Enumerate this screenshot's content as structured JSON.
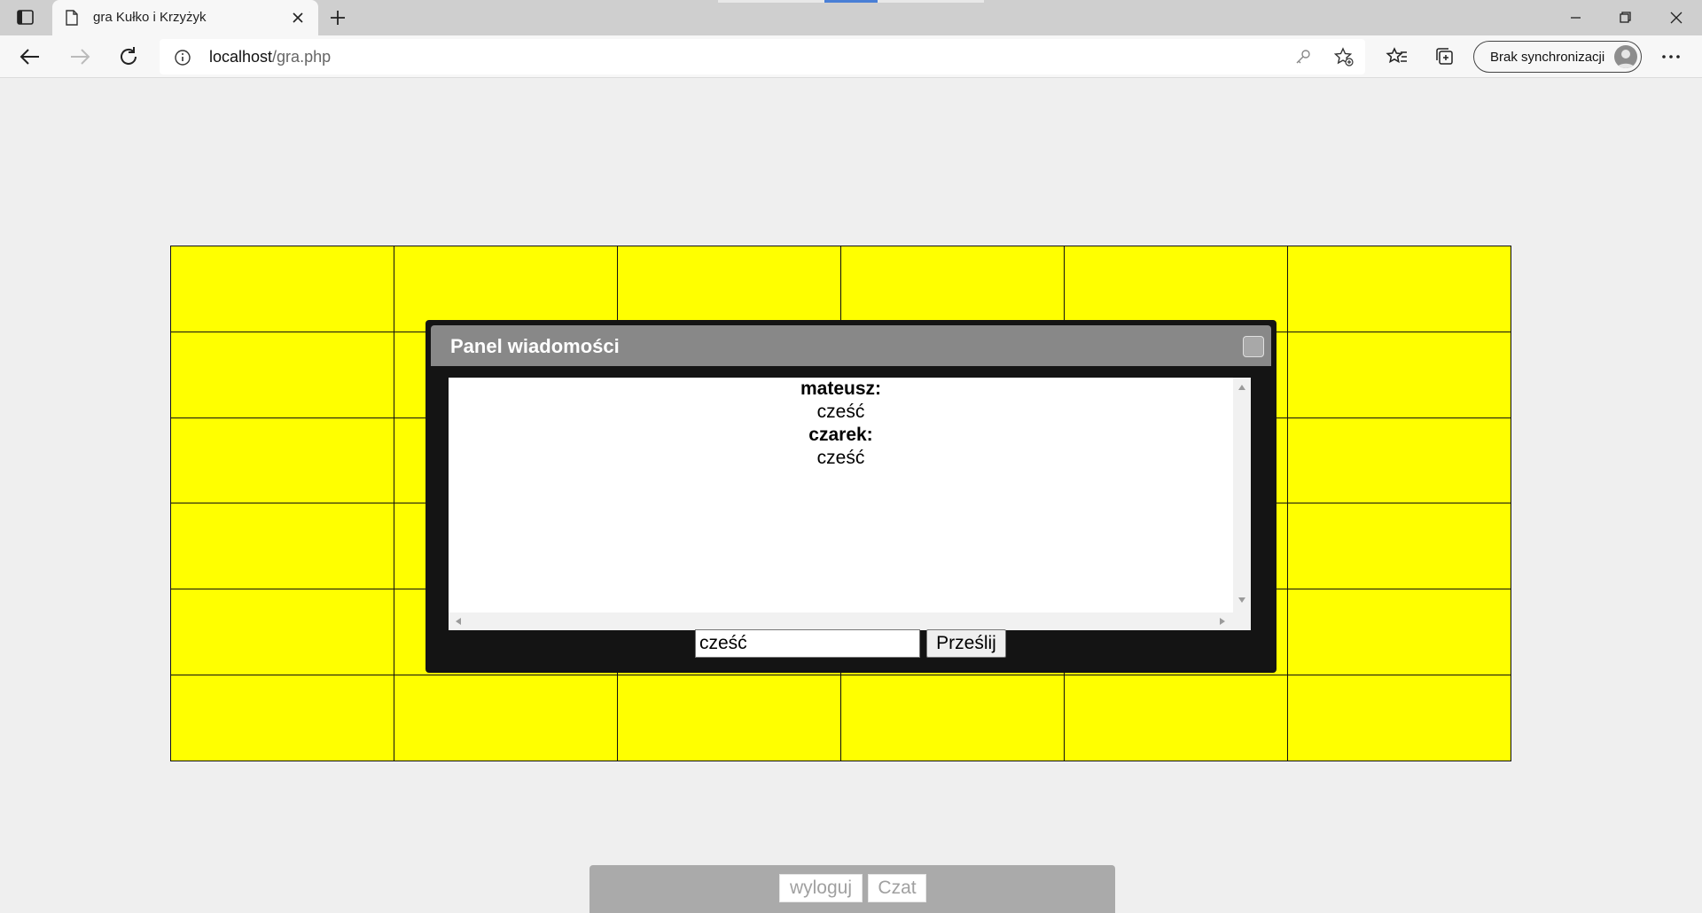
{
  "browser": {
    "tab_title": "gra Kułko i Krzyżyk",
    "url_host": "localhost",
    "url_path": "/gra.php",
    "sync_label": "Brak synchronizacji"
  },
  "panel": {
    "title": "Panel wiadomości",
    "messages": [
      {
        "author": "mateusz:",
        "text": "cześć"
      },
      {
        "author": "czarek:",
        "text": "cześć"
      }
    ],
    "input_value": "cześć",
    "send_label": "Prześlij"
  },
  "bottom": {
    "logout_label": "wyloguj",
    "chat_label": "Czat"
  },
  "board": {
    "rows": 6,
    "cols": 6,
    "cell_color": "#ffff00"
  },
  "colors": {
    "panel_bg": "#141414",
    "panel_header": "#888888",
    "page_bg": "#efefef"
  }
}
